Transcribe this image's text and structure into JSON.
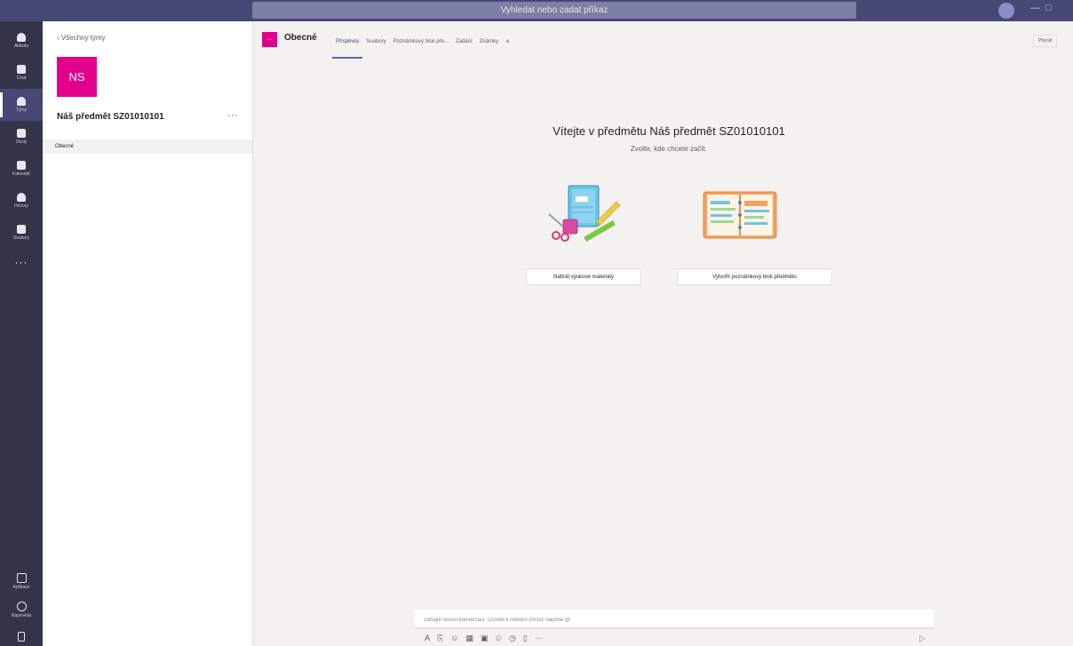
{
  "titlebar": {
    "search_placeholder": "Vyhledat nebo zadat příkaz"
  },
  "rail": {
    "items": [
      {
        "label": "Aktivita",
        "icon": "bell-icon"
      },
      {
        "label": "Chat",
        "icon": "chat-icon"
      },
      {
        "label": "Týmy",
        "icon": "teams-icon"
      },
      {
        "label": "Úkoly",
        "icon": "assignments-icon"
      },
      {
        "label": "Kalendář",
        "icon": "calendar-icon"
      },
      {
        "label": "Hovory",
        "icon": "phone-icon"
      },
      {
        "label": "Soubory",
        "icon": "files-icon"
      }
    ],
    "more": "···",
    "bottom_items": [
      {
        "label": "Aplikace",
        "icon": "apps-icon"
      },
      {
        "label": "Nápověda",
        "icon": "help-icon"
      }
    ]
  },
  "team": {
    "back_label": "‹  Všechny týmy",
    "avatar_initials": "NS",
    "name": "Náš předmět SZ01010101",
    "more": "···",
    "channels": [
      {
        "name": "Obecné"
      }
    ]
  },
  "header": {
    "channel_avatar": "···",
    "channel_title": "Obecné",
    "tabs": [
      {
        "label": "Příspěvky"
      },
      {
        "label": "Soubory"
      },
      {
        "label": "Poznámkový blok pře..."
      },
      {
        "label": "Zadání"
      },
      {
        "label": "Známky"
      }
    ],
    "add_tab": "+",
    "meet_label": "Připojit"
  },
  "welcome": {
    "title": "Vítejte v předmětu Náš předmět SZ01010101",
    "subtitle": "Zvolte, kde chcete začít.",
    "button_materials": "Nahrát výukové materiály",
    "button_notebook": "Vytvořit poznámkový blok předmětu"
  },
  "compose": {
    "placeholder": "Zahajte novou konverzaci. Chcete-li někoho zmínit, napište @."
  },
  "colors": {
    "brand": "#464775",
    "rail": "#33344a",
    "accent": "#e3008c"
  }
}
